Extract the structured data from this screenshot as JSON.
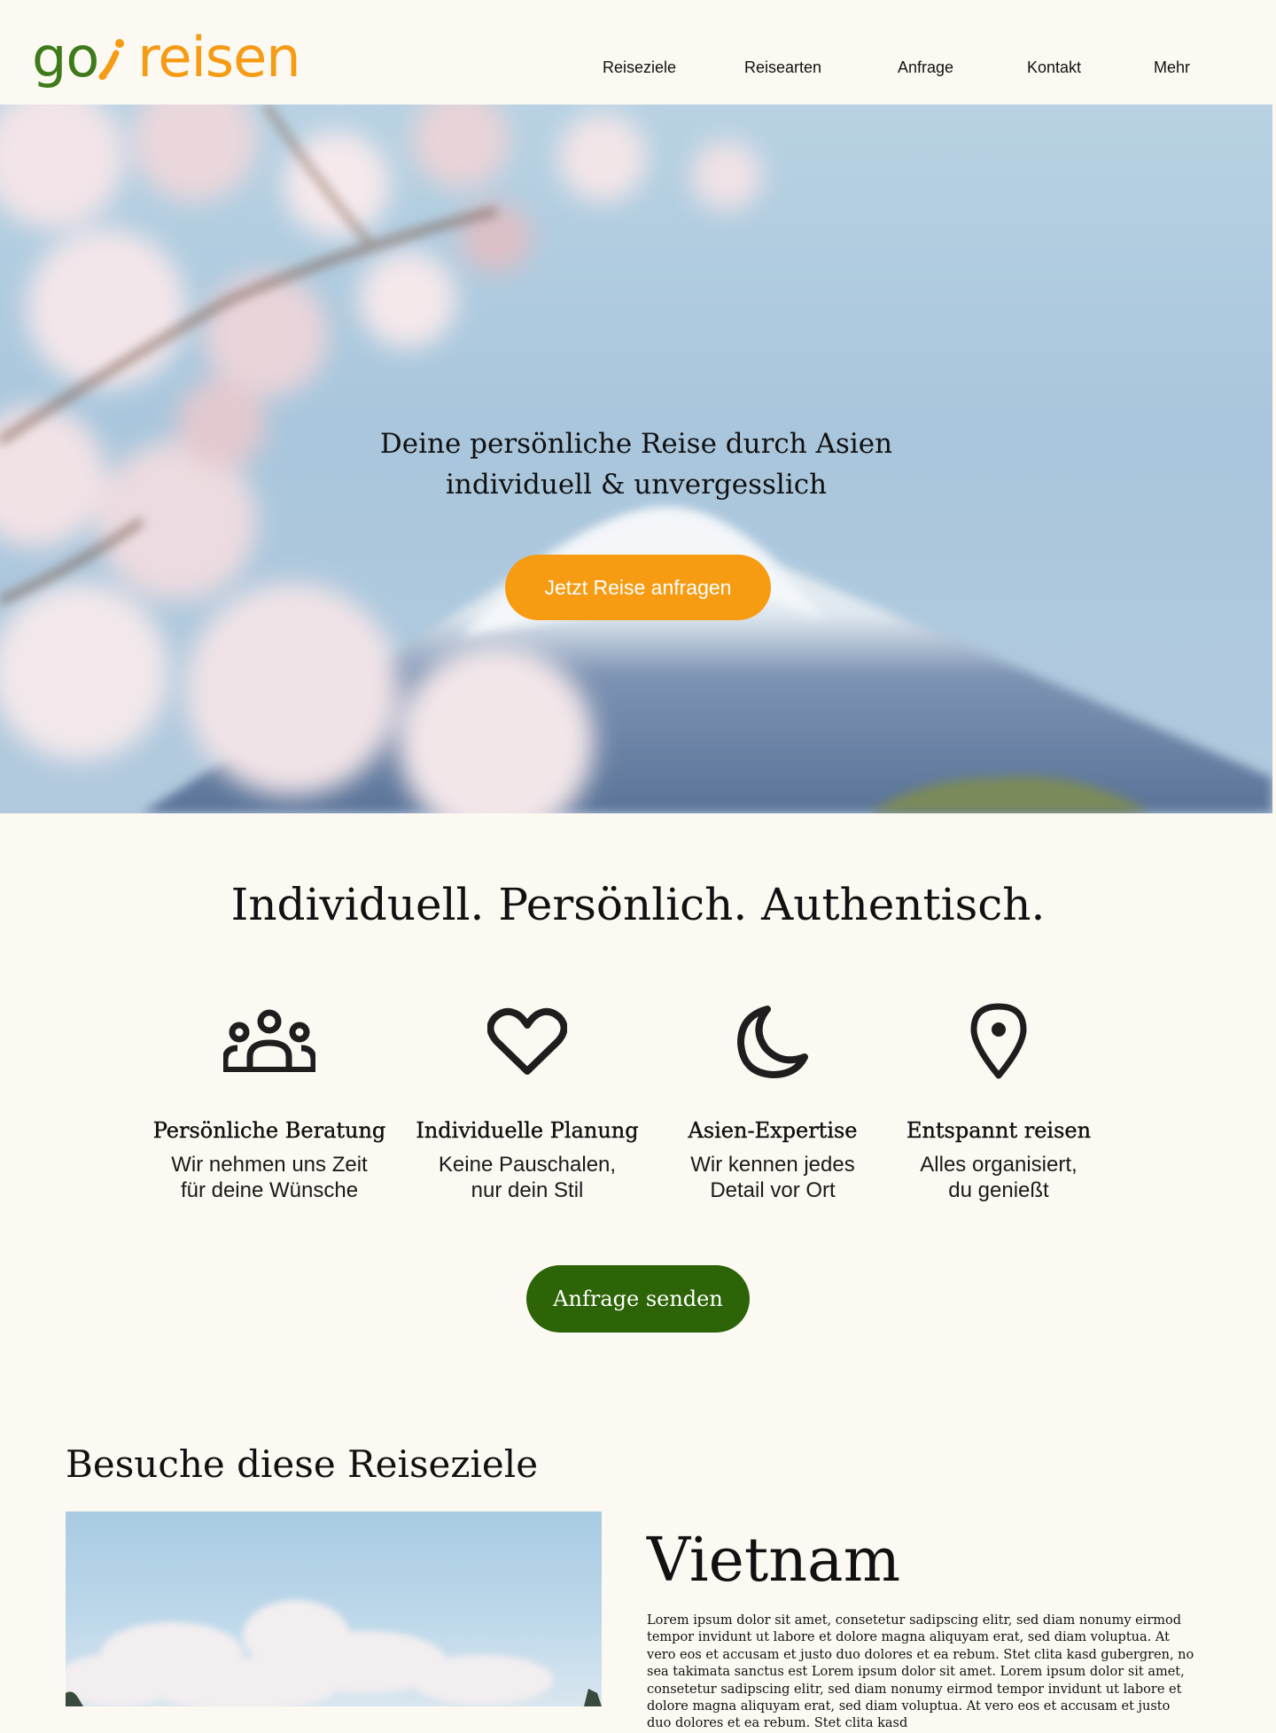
{
  "brand": {
    "part1": "go",
    "part2": "reisen",
    "go_color": "#3e7a1a",
    "accent_color": "#f59b14"
  },
  "nav": {
    "items": [
      {
        "label": "Reiseziele"
      },
      {
        "label": "Reisearten"
      },
      {
        "label": "Anfrage"
      },
      {
        "label": "Kontakt"
      },
      {
        "label": "Mehr"
      }
    ]
  },
  "hero": {
    "line1": "Deine persönliche Reise durch Asien",
    "line2": "individuell & unvergesslich",
    "cta_label": "Jetzt Reise anfragen",
    "cta_color": "#f79b12"
  },
  "intro": {
    "tagline": "Individuell. Persönlich. Authentisch.",
    "features": [
      {
        "icon": "people-group-icon",
        "title": "Persönliche Beratung",
        "line1": "Wir nehmen uns Zeit",
        "line2": "für deine Wünsche"
      },
      {
        "icon": "heart-icon",
        "title": "Individuelle Planung",
        "line1": "Keine Pauschalen,",
        "line2": "nur dein Stil"
      },
      {
        "icon": "moon-icon",
        "title": "Asien-Expertise",
        "line1": "Wir kennen jedes",
        "line2": "Detail vor Ort"
      },
      {
        "icon": "location-pin-icon",
        "title": "Entspannt reisen",
        "line1": "Alles organisiert,",
        "line2": "du genießt"
      }
    ],
    "send_label": "Anfrage senden",
    "send_color": "#2c6407"
  },
  "destinations": {
    "heading": "Besuche diese Reiseziele",
    "featured": {
      "name": "Vietnam",
      "description": "Lorem ipsum dolor sit amet, consetetur sadipscing elitr, sed diam nonumy eirmod tempor invidunt ut labore et dolore magna aliquyam erat, sed diam voluptua. At vero eos et accusam et justo duo dolores et ea rebum. Stet clita kasd gubergren, no sea takimata sanctus est Lorem ipsum dolor sit amet. Lorem ipsum dolor sit amet, consetetur sadipscing elitr, sed diam nonumy eirmod tempor invidunt ut labore et dolore magna aliquyam erat, sed diam voluptua. At vero eos et accusam et justo duo dolores et ea rebum. Stet clita kasd"
    }
  }
}
